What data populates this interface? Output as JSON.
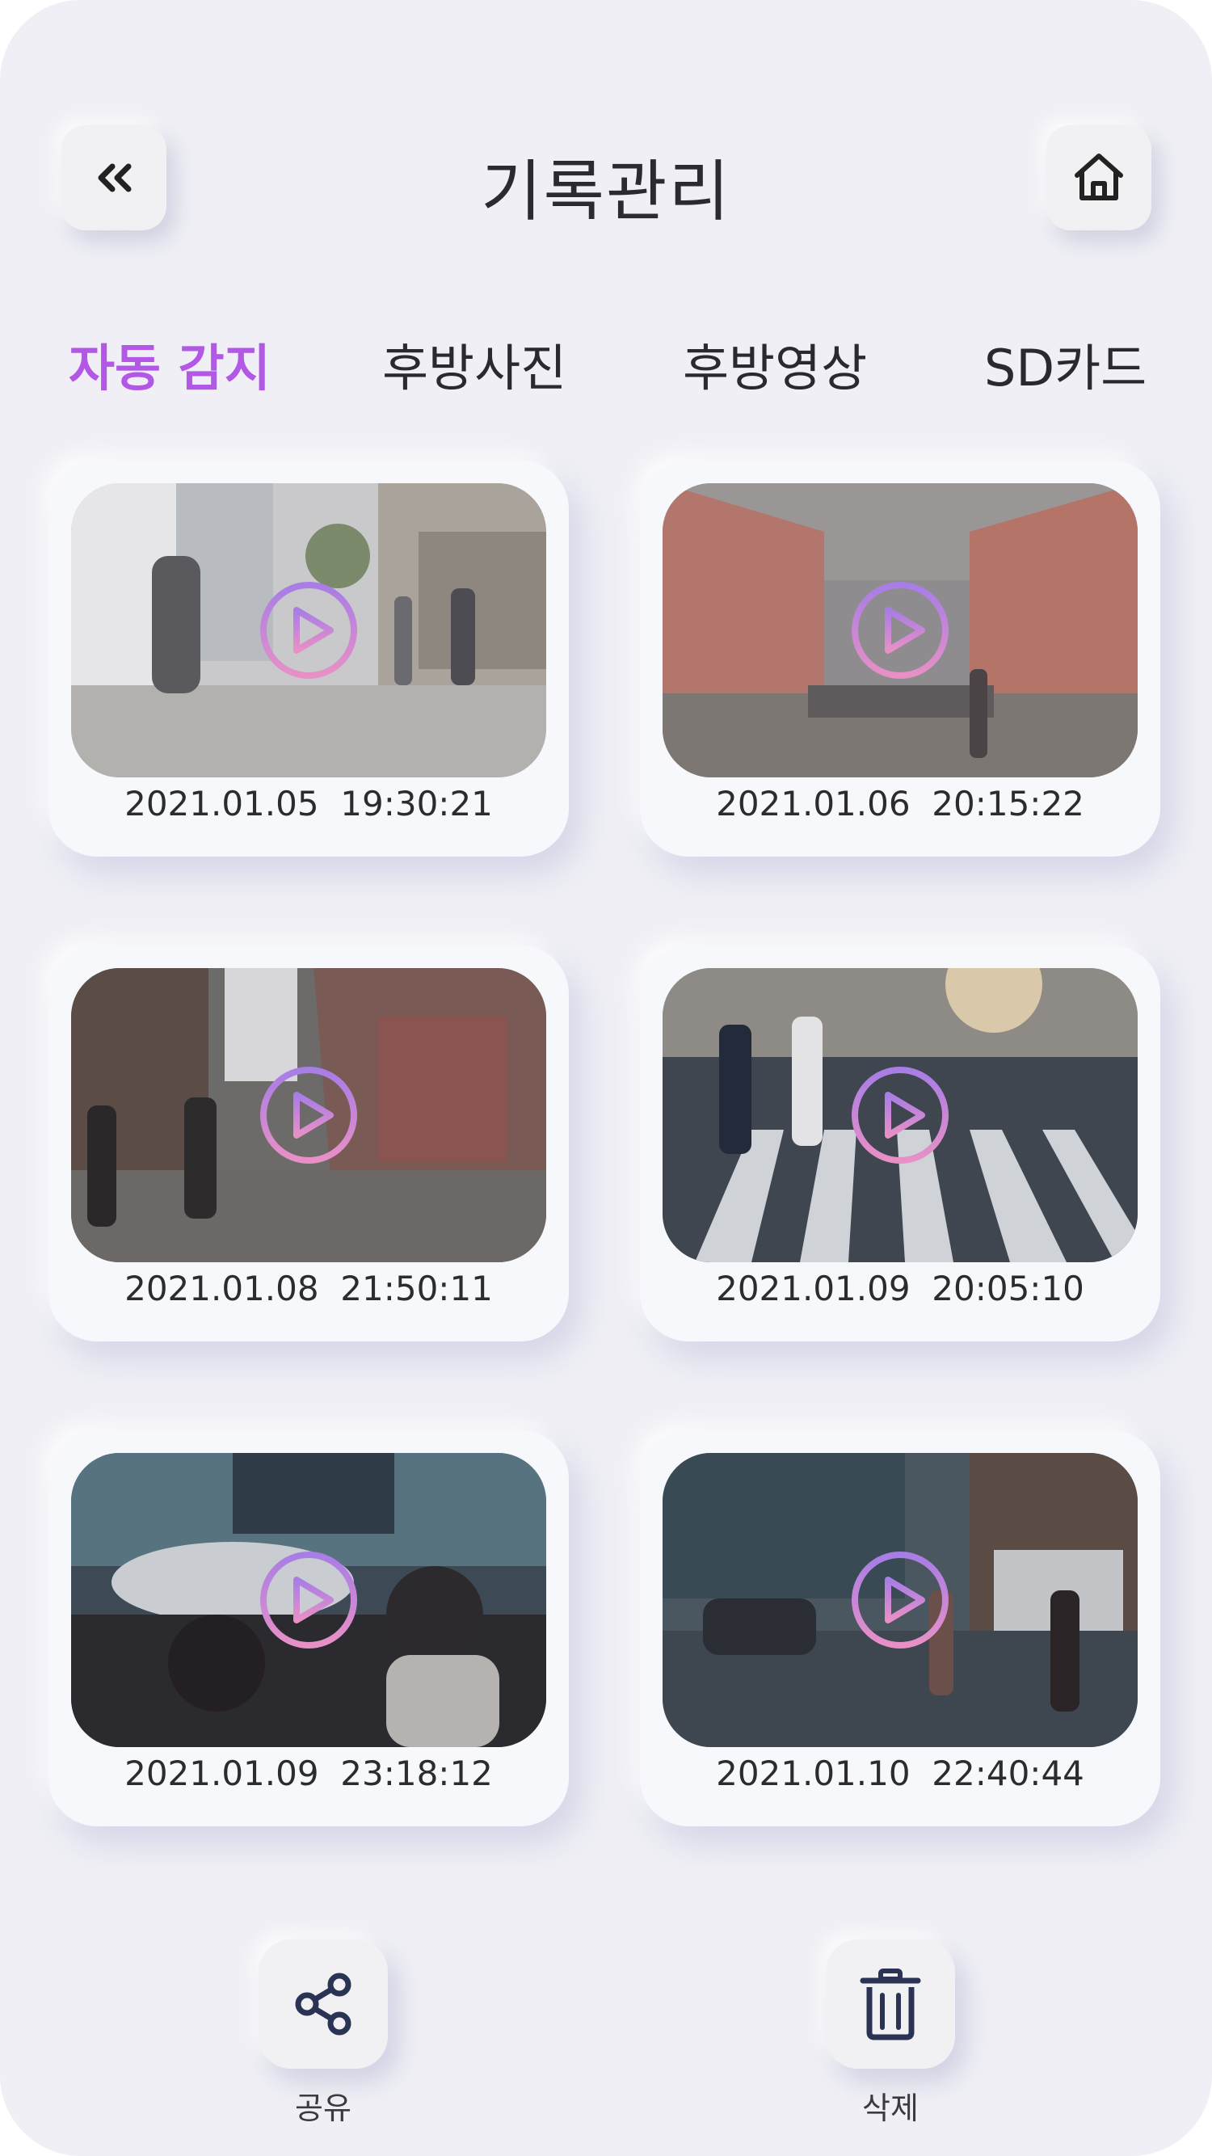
{
  "header": {
    "title": "기록관리",
    "back_icon": "double-chevron-left-icon",
    "home_icon": "home-icon"
  },
  "tabs": [
    {
      "label": "자동 감지",
      "active": true
    },
    {
      "label": "후방사진",
      "active": false
    },
    {
      "label": "후방영상",
      "active": false
    },
    {
      "label": "SD카드",
      "active": false
    }
  ],
  "colors": {
    "accent": "#b257e6",
    "background": "#efeff5",
    "icon": "#2a3353"
  },
  "recordings": [
    {
      "timestamp": "2021.01.05  19:30:21"
    },
    {
      "timestamp": "2021.01.06  20:15:22"
    },
    {
      "timestamp": "2021.01.08  21:50:11"
    },
    {
      "timestamp": "2021.01.09  20:05:10"
    },
    {
      "timestamp": "2021.01.09  23:18:12"
    },
    {
      "timestamp": "2021.01.10  22:40:44"
    }
  ],
  "actions": {
    "share_label": "공유",
    "delete_label": "삭제"
  }
}
